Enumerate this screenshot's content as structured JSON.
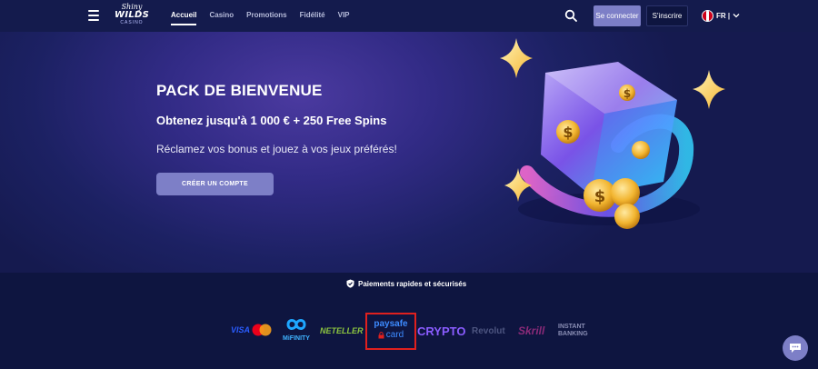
{
  "header": {
    "menu_icon": "hamburger-icon",
    "logo": {
      "line1": "Shiny",
      "line2": "WILDS",
      "line3": "CASINO"
    },
    "nav": [
      "Accueil",
      "Casino",
      "Promotions",
      "Fidélité",
      "VIP"
    ],
    "active_nav": "Accueil",
    "login_label": "Se connecter",
    "signup_label": "S'inscrire",
    "language": "FR |"
  },
  "hero": {
    "title": "PACK DE BIENVENUE",
    "subtitle": "Obtenez jusqu'à 1 000 € + 250 Free Spins",
    "description": "Réclamez vos bonus et jouez à vos jeux préférés!",
    "cta_label": "CRÉER UN COMPTE"
  },
  "payments": {
    "label": "Paiements rapides et sécurisés",
    "logos": {
      "visa": "VISA",
      "mifinity": "MiFINITY",
      "neteller": "NETELLER",
      "paysafe_top": "paysafe",
      "paysafe_bottom": "card",
      "crypto": "CRYPTO",
      "revolut": "Revolut",
      "skrill": "Skrill",
      "instant_banking_1": "INSTANT",
      "instant_banking_2": "BANKING"
    }
  },
  "colors": {
    "header_bg": "#141b4d",
    "accent": "#7d7fc7",
    "highlight_border": "#e0201e"
  }
}
